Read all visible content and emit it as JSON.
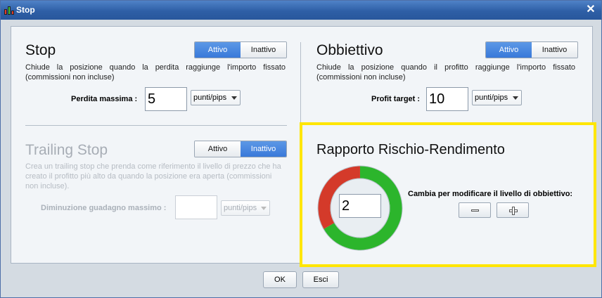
{
  "window": {
    "title": "Stop",
    "app_icon": "bar-chart-icon",
    "close_glyph": "✕"
  },
  "stop": {
    "title": "Stop",
    "toggle": {
      "on": "Attivo",
      "off": "Inattivo",
      "active": "on"
    },
    "description": "Chiude la posizione quando la perdita raggiunge l'importo fissato (commissioni non incluse)",
    "field_label": "Perdita massima :",
    "value": "5",
    "unit": "punti/pips"
  },
  "target": {
    "title": "Obbiettivo",
    "toggle": {
      "on": "Attivo",
      "off": "Inattivo",
      "active": "on"
    },
    "description": "Chiude la posizione quando il profitto raggiunge l'importo fissato (commissioni non incluse)",
    "field_label": "Profit target :",
    "value": "10",
    "unit": "punti/pips"
  },
  "trailing": {
    "title": "Trailing Stop",
    "toggle": {
      "on": "Attivo",
      "off": "Inattivo",
      "active": "off"
    },
    "description": "Crea un trailing stop che prenda come riferimento il livello di prezzo che ha creato il profitto più alto da quando la posizione era aperta (commissioni non incluse).",
    "field_label": "Diminuzione guadagno massimo :",
    "value": "",
    "unit": "punti/pips"
  },
  "risk_reward": {
    "title": "Rapporto Rischio-Rendimento",
    "ratio": "2",
    "risk_fraction": 0.3333,
    "hint": "Cambia per modificare il livello di obbiettivo:",
    "colors": {
      "risk": "#d43a2a",
      "reward": "#2cb52c",
      "highlight": "#ffe600"
    }
  },
  "footer": {
    "ok": "OK",
    "cancel": "Esci"
  }
}
